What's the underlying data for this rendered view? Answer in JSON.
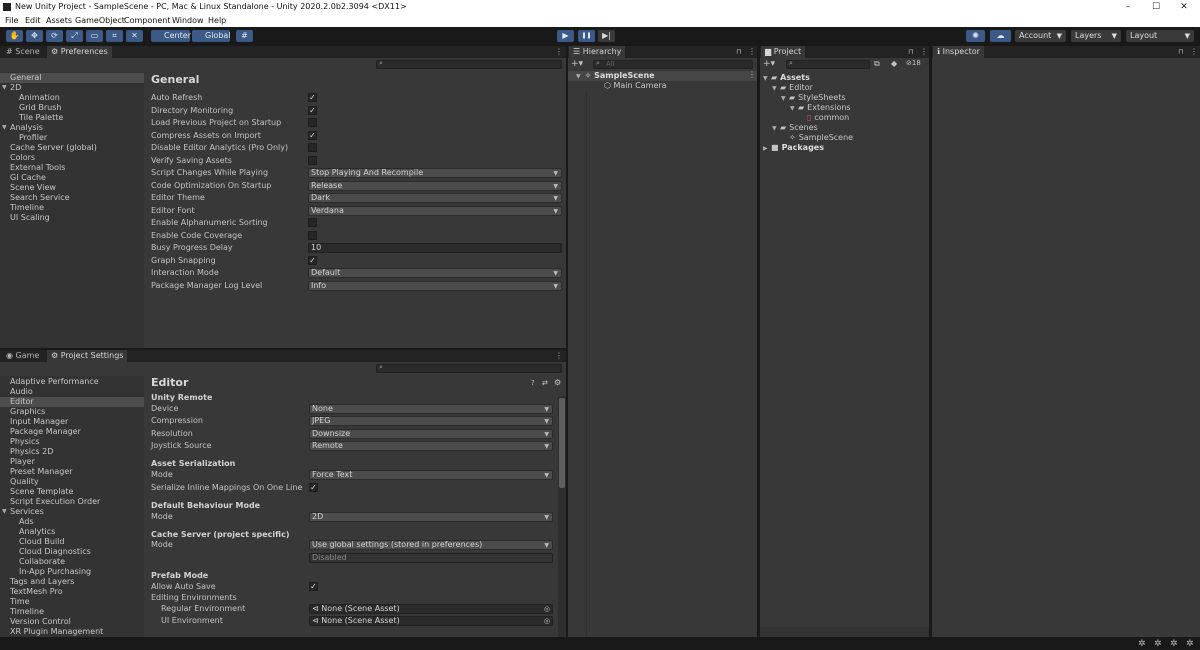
{
  "window": {
    "title": "New Unity Project - SampleScene - PC, Mac & Linux Standalone - Unity 2020.2.0b2.3094 <DX11>",
    "controls": {
      "minimize": "–",
      "maximize": "☐",
      "close": "✕"
    }
  },
  "menu": [
    "File",
    "Edit",
    "Assets",
    "GameObject",
    "Component",
    "Window",
    "Help"
  ],
  "toolbar": {
    "pivot_label": "Center",
    "space_label": "Global",
    "account_label": "Account",
    "layers_label": "Layers",
    "layout_label": "Layout",
    "tool_icons": [
      "✋",
      "✥",
      "⟳",
      "⤢",
      "▭",
      "⌗",
      "✕"
    ],
    "play_icons": [
      "▶",
      "❚❚",
      "▶|"
    ]
  },
  "preferences": {
    "tabs": [
      "Scene",
      "Preferences"
    ],
    "section_title": "General",
    "categories": [
      {
        "label": "General",
        "level": 0,
        "selected": true
      },
      {
        "label": "2D",
        "level": 0,
        "expander": "▼"
      },
      {
        "label": "Animation",
        "level": 1
      },
      {
        "label": "Grid Brush",
        "level": 1
      },
      {
        "label": "Tile Palette",
        "level": 1
      },
      {
        "label": "Analysis",
        "level": 0,
        "expander": "▼"
      },
      {
        "label": "Profiler",
        "level": 1
      },
      {
        "label": "Cache Server (global)",
        "level": 0
      },
      {
        "label": "Colors",
        "level": 0
      },
      {
        "label": "External Tools",
        "level": 0
      },
      {
        "label": "GI Cache",
        "level": 0
      },
      {
        "label": "Scene View",
        "level": 0
      },
      {
        "label": "Search Service",
        "level": 0
      },
      {
        "label": "Timeline",
        "level": 0
      },
      {
        "label": "UI Scaling",
        "level": 0
      }
    ],
    "settings": [
      {
        "label": "Auto Refresh",
        "type": "check",
        "checked": true
      },
      {
        "label": "Directory Monitoring",
        "type": "check",
        "checked": true
      },
      {
        "label": "Load Previous Project on Startup",
        "type": "check",
        "checked": false
      },
      {
        "label": "Compress Assets on Import",
        "type": "check",
        "checked": true
      },
      {
        "label": "Disable Editor Analytics (Pro Only)",
        "type": "check",
        "checked": false
      },
      {
        "label": "Verify Saving Assets",
        "type": "check",
        "checked": false
      },
      {
        "label": "Script Changes While Playing",
        "type": "dropdown",
        "value": "Stop Playing And Recompile"
      },
      {
        "label": "Code Optimization On Startup",
        "type": "dropdown",
        "value": "Release"
      },
      {
        "label": "Editor Theme",
        "type": "dropdown",
        "value": "Dark"
      },
      {
        "label": "Editor Font",
        "type": "dropdown",
        "value": "Verdana"
      },
      {
        "label": "Enable Alphanumeric Sorting",
        "type": "check",
        "checked": false
      },
      {
        "label": "Enable Code Coverage",
        "type": "check",
        "checked": false
      },
      {
        "label": "Busy Progress Delay",
        "type": "text",
        "value": "10"
      },
      {
        "label": "Graph Snapping",
        "type": "check",
        "checked": true
      },
      {
        "label": "Interaction Mode",
        "type": "dropdown",
        "value": "Default"
      },
      {
        "label": "Package Manager Log Level",
        "type": "dropdown",
        "value": "Info"
      }
    ]
  },
  "project_settings": {
    "tabs": [
      "Game",
      "Project Settings"
    ],
    "section_title": "Editor",
    "categories": [
      {
        "label": "Adaptive Performance",
        "level": 0
      },
      {
        "label": "Audio",
        "level": 0
      },
      {
        "label": "Editor",
        "level": 0,
        "selected": true
      },
      {
        "label": "Graphics",
        "level": 0
      },
      {
        "label": "Input Manager",
        "level": 0
      },
      {
        "label": "Package Manager",
        "level": 0
      },
      {
        "label": "Physics",
        "level": 0
      },
      {
        "label": "Physics 2D",
        "level": 0
      },
      {
        "label": "Player",
        "level": 0
      },
      {
        "label": "Preset Manager",
        "level": 0
      },
      {
        "label": "Quality",
        "level": 0
      },
      {
        "label": "Scene Template",
        "level": 0
      },
      {
        "label": "Script Execution Order",
        "level": 0
      },
      {
        "label": "Services",
        "level": 0,
        "expander": "▼"
      },
      {
        "label": "Ads",
        "level": 1
      },
      {
        "label": "Analytics",
        "level": 1
      },
      {
        "label": "Cloud Build",
        "level": 1
      },
      {
        "label": "Cloud Diagnostics",
        "level": 1
      },
      {
        "label": "Collaborate",
        "level": 1
      },
      {
        "label": "In-App Purchasing",
        "level": 1
      },
      {
        "label": "Tags and Layers",
        "level": 0
      },
      {
        "label": "TextMesh Pro",
        "level": 0
      },
      {
        "label": "Time",
        "level": 0
      },
      {
        "label": "Timeline",
        "level": 0
      },
      {
        "label": "Version Control",
        "level": 0
      },
      {
        "label": "XR Plugin Management",
        "level": 0
      }
    ],
    "unity_remote": {
      "heading": "Unity Remote",
      "rows": [
        {
          "label": "Device",
          "value": "None"
        },
        {
          "label": "Compression",
          "value": "JPEG"
        },
        {
          "label": "Resolution",
          "value": "Downsize"
        },
        {
          "label": "Joystick Source",
          "value": "Remote"
        }
      ]
    },
    "asset_serialization": {
      "heading": "Asset Serialization",
      "mode_label": "Mode",
      "mode_value": "Force Text",
      "inline_label": "Serialize Inline Mappings On One Line",
      "inline_checked": true
    },
    "default_behaviour": {
      "heading": "Default Behaviour Mode",
      "mode_label": "Mode",
      "mode_value": "2D"
    },
    "cache_server": {
      "heading": "Cache Server (project specific)",
      "mode_label": "Mode",
      "mode_value": "Use global settings (stored in preferences)",
      "status_value": "Disabled"
    },
    "prefab_mode": {
      "heading": "Prefab Mode",
      "allow_label": "Allow Auto Save",
      "allow_checked": true,
      "env_label": "Editing Environments",
      "regular_label": "Regular Environment",
      "regular_value": "None (Scene Asset)",
      "ui_label": "UI Environment",
      "ui_value": "None (Scene Asset)"
    }
  },
  "hierarchy": {
    "tab": "Hierarchy",
    "search_placeholder": "All",
    "items": [
      {
        "label": "SampleScene",
        "bold": true,
        "level": 0
      },
      {
        "label": "Main Camera",
        "bold": false,
        "level": 1
      }
    ]
  },
  "project": {
    "tab": "Project",
    "hidden_count": "18",
    "tree": [
      {
        "label": "Assets",
        "level": 0,
        "bold": true,
        "expander": "▼",
        "icon": "folder-open-icon"
      },
      {
        "label": "Editor",
        "level": 1,
        "expander": "▼",
        "icon": "folder-open-icon"
      },
      {
        "label": "StyleSheets",
        "level": 2,
        "expander": "▼",
        "icon": "folder-open-icon"
      },
      {
        "label": "Extensions",
        "level": 3,
        "expander": "▼",
        "icon": "folder-open-icon"
      },
      {
        "label": "common",
        "level": 4,
        "icon": "stylesheet-icon"
      },
      {
        "label": "Scenes",
        "level": 1,
        "expander": "▼",
        "icon": "folder-open-icon"
      },
      {
        "label": "SampleScene",
        "level": 2,
        "icon": "scene-icon"
      },
      {
        "label": "Packages",
        "level": 0,
        "bold": true,
        "expander": "▶",
        "icon": "folder-closed-icon"
      }
    ]
  },
  "inspector": {
    "tab": "Inspector"
  },
  "icons": {
    "check": "✓",
    "dropdown": "▼",
    "kebab": "⋮",
    "lock": "🔒",
    "search": "⌕",
    "plus": "+▾",
    "scene": "✧",
    "camera": "⬡",
    "gear": "⚙",
    "hash": "#",
    "info": "ℹ",
    "help": "?",
    "sliders": "⇄",
    "target": "◎",
    "scene_asset": "⊲",
    "cloud": "☁",
    "collab": "✺"
  }
}
